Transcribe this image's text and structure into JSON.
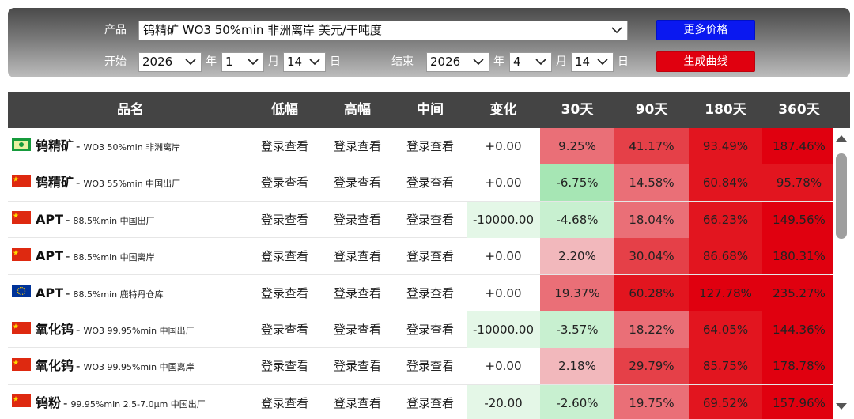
{
  "controls": {
    "product_label": "产品",
    "product_value": "钨精矿 WO3 50%min 非洲离岸 美元/干吨度",
    "start_label": "开始",
    "end_label": "结束",
    "start": {
      "year": "2026",
      "year_unit": "年",
      "month": "1",
      "month_unit": "月",
      "day": "14",
      "day_unit": "日"
    },
    "end": {
      "year": "2026",
      "year_unit": "年",
      "month": "4",
      "month_unit": "月",
      "day": "14",
      "day_unit": "日"
    },
    "more_prices_button": "更多价格",
    "generate_curve_button": "生成曲线"
  },
  "table": {
    "headers": [
      "品名",
      "低幅",
      "高幅",
      "中间",
      "变化",
      "30天",
      "90天",
      "180天",
      "360天"
    ],
    "rows": [
      {
        "flag": "africa",
        "name": "钨精矿",
        "sep": "-",
        "desc": "WO3 50%min 非洲离岸",
        "low": "登录查看",
        "high": "登录查看",
        "mid": "登录查看",
        "change": "+0.00",
        "d30": "9.25%",
        "d90": "41.17%",
        "d180": "93.49%",
        "d360": "187.46%"
      },
      {
        "flag": "cn",
        "name": "钨精矿",
        "sep": "-",
        "desc": "WO3 55%min 中国出厂",
        "low": "登录查看",
        "high": "登录查看",
        "mid": "登录查看",
        "change": "+0.00",
        "d30": "-6.75%",
        "d90": "14.58%",
        "d180": "60.84%",
        "d360": "95.78%"
      },
      {
        "flag": "cn",
        "name": "APT",
        "sep": "-",
        "desc": "88.5%min 中国出厂",
        "low": "登录查看",
        "high": "登录查看",
        "mid": "登录查看",
        "change": "-10000.00",
        "d30": "-4.68%",
        "d90": "18.04%",
        "d180": "66.23%",
        "d360": "149.56%"
      },
      {
        "flag": "cn",
        "name": "APT",
        "sep": "-",
        "desc": "88.5%min 中国离岸",
        "low": "登录查看",
        "high": "登录查看",
        "mid": "登录查看",
        "change": "+0.00",
        "d30": "2.20%",
        "d90": "30.04%",
        "d180": "86.68%",
        "d360": "180.31%"
      },
      {
        "flag": "eu",
        "name": "APT",
        "sep": "-",
        "desc": "88.5%min 鹿特丹仓库",
        "low": "登录查看",
        "high": "登录查看",
        "mid": "登录查看",
        "change": "+0.00",
        "d30": "19.37%",
        "d90": "60.28%",
        "d180": "127.78%",
        "d360": "235.27%"
      },
      {
        "flag": "cn",
        "name": "氧化钨",
        "sep": "-",
        "desc": "WO3 99.95%min 中国出厂",
        "low": "登录查看",
        "high": "登录查看",
        "mid": "登录查看",
        "change": "-10000.00",
        "d30": "-3.57%",
        "d90": "18.22%",
        "d180": "64.05%",
        "d360": "144.36%"
      },
      {
        "flag": "cn",
        "name": "氧化钨",
        "sep": "-",
        "desc": "WO3 99.95%min 中国离岸",
        "low": "登录查看",
        "high": "登录查看",
        "mid": "登录查看",
        "change": "+0.00",
        "d30": "2.18%",
        "d90": "29.79%",
        "d180": "85.75%",
        "d360": "178.78%"
      },
      {
        "flag": "cn",
        "name": "钨粉",
        "sep": "-",
        "desc": "99.95%min 2.5-7.0μm 中国出厂",
        "low": "登录查看",
        "high": "登录查看",
        "mid": "登录查看",
        "change": "-20.00",
        "d30": "-2.60%",
        "d90": "19.75%",
        "d180": "69.52%",
        "d360": "157.96%"
      }
    ]
  },
  "colors": {
    "header_bg": "#444444",
    "button_blue": "#0a18f0",
    "button_red": "#e0000f",
    "up_light": "#f2b8bc",
    "up_mid": "#ea6f77",
    "up_strong": "#e0000f",
    "down_light": "#c8f0d0",
    "down_mid": "#a6e6b4"
  }
}
